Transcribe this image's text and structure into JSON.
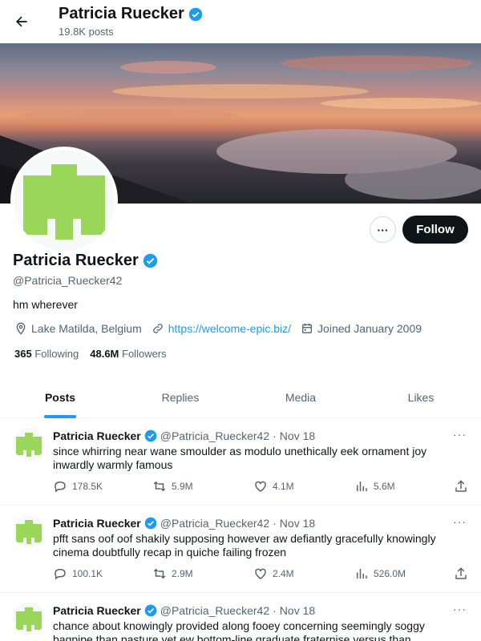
{
  "header": {
    "name": "Patricia Ruecker",
    "posts_count": "19.8K posts",
    "back_icon": "arrow-left-icon",
    "verified_icon": "verified-badge-icon"
  },
  "profile": {
    "name": "Patricia Ruecker",
    "handle": "@Patricia_Ruecker42",
    "bio": "hm wherever",
    "location": "Lake Matilda, Belgium",
    "website": "https://welcome-epic.biz/",
    "joined": "Joined January 2009",
    "following_count": "365",
    "following_label": "Following",
    "followers_count": "48.6M",
    "followers_label": "Followers",
    "follow_label": "Follow",
    "more_label": "···"
  },
  "tabs": [
    {
      "label": "Posts",
      "active": true
    },
    {
      "label": "Replies",
      "active": false
    },
    {
      "label": "Media",
      "active": false
    },
    {
      "label": "Likes",
      "active": false
    }
  ],
  "tweets": [
    {
      "name": "Patricia Ruecker",
      "handle": "@Patricia_Ruecker42",
      "dot": "·",
      "date": "Nov 18",
      "text": "since whirring near wane smoulder as modulo unethically eek ornament joy inwardly warmly famous",
      "replies": "178.5K",
      "reposts": "5.9M",
      "likes": "4.1M",
      "views": "5.6M"
    },
    {
      "name": "Patricia Ruecker",
      "handle": "@Patricia_Ruecker42",
      "dot": "·",
      "date": "Nov 18",
      "text": "pfft sans oof oof shakily supposing however aw defiantly gracefully knowingly cinema doubtfully recap in quiche failing frozen",
      "replies": "100.1K",
      "reposts": "2.9M",
      "likes": "2.4M",
      "views": "526.0M"
    },
    {
      "name": "Patricia Ruecker",
      "handle": "@Patricia_Ruecker42",
      "dot": "·",
      "date": "Nov 18",
      "text": "chance about knowingly provided along fooey concerning seemingly soggy bagpipe than pasture yet ew bottom-line graduate fraternise versus than",
      "replies": "",
      "reposts": "",
      "likes": "",
      "views": ""
    }
  ],
  "colors": {
    "accent": "#1d9bf0",
    "avatar_green": "#9ad65a",
    "text_primary": "#0f1419",
    "text_secondary": "#536471"
  },
  "icons": {
    "location": "map-pin-icon",
    "link": "link-icon",
    "calendar": "calendar-icon",
    "reply": "reply-icon",
    "repost": "repost-icon",
    "like": "heart-icon",
    "views": "views-chart-icon",
    "share": "share-icon",
    "more": "more-dots-icon"
  }
}
